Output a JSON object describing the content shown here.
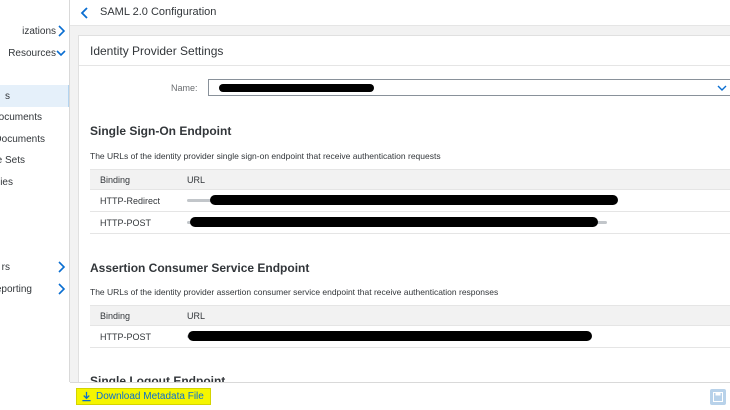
{
  "header": {
    "title": "SAML 2.0 Configuration"
  },
  "sidebar": {
    "items": [
      {
        "label": "izations",
        "chevron": "right"
      },
      {
        "label": "Resources",
        "chevron": "down"
      },
      {
        "label": "s",
        "active": true
      },
      {
        "label": "ocuments"
      },
      {
        "label": "Documents"
      },
      {
        "label": "e Sets"
      },
      {
        "label": "ies"
      },
      {
        "label": "rs",
        "chevron": "right"
      },
      {
        "label": "eporting",
        "chevron": "right"
      }
    ]
  },
  "panel": {
    "title": "Identity Provider Settings",
    "name_label": "Name:",
    "sso": {
      "title": "Single Sign-On Endpoint",
      "description": "The URLs of the identity provider single sign-on endpoint that receive authentication requests",
      "columns": [
        "Binding",
        "URL"
      ],
      "rows": [
        {
          "binding": "HTTP-Redirect"
        },
        {
          "binding": "HTTP-POST"
        }
      ]
    },
    "acs": {
      "title": "Assertion Consumer Service Endpoint",
      "description": "The URLs of the identity provider assertion consumer service endpoint that receive authentication responses",
      "columns": [
        "Binding",
        "URL"
      ],
      "rows": [
        {
          "binding": "HTTP-POST"
        }
      ]
    },
    "slo": {
      "title": "Single Logout Endpoint"
    }
  },
  "footer": {
    "download_label": "Download Metadata File"
  },
  "icons": {
    "back": "chevron-left-icon",
    "dropdown": "chevron-down-icon",
    "download": "download-icon",
    "save": "save-icon"
  },
  "colors": {
    "accent": "#0a6ed1",
    "highlight": "#f5f500",
    "active_nav": "#e5f0fa"
  }
}
